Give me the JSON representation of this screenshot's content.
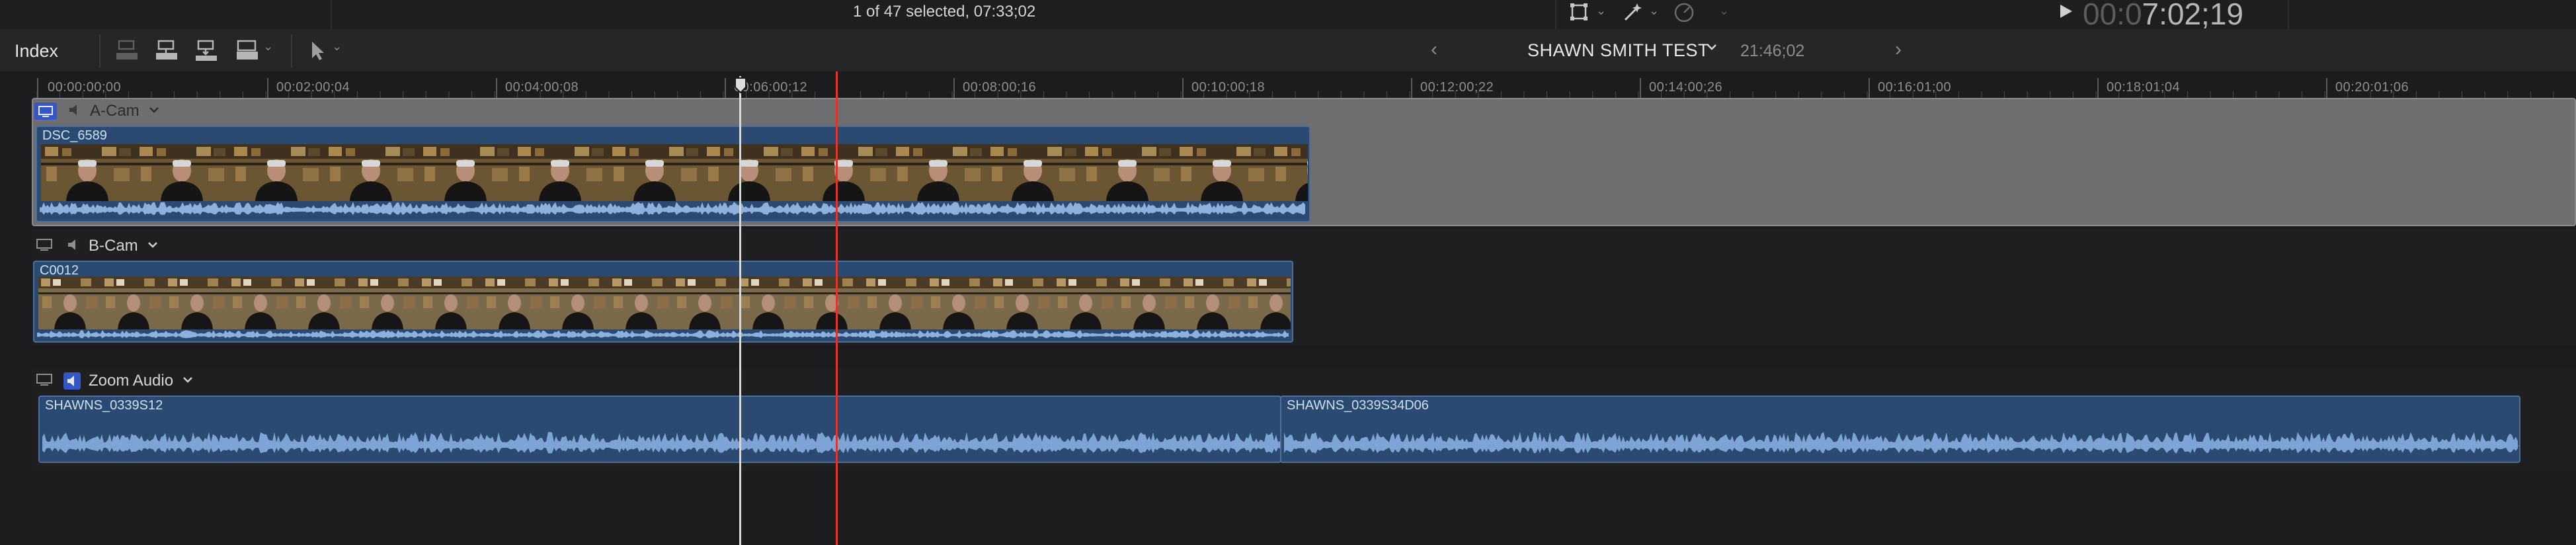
{
  "status": {
    "selection_text": "1 of 47 selected, 07:33;02",
    "timecode_dim": "00:0",
    "timecode_lit": "7:02;19"
  },
  "toolbar": {
    "index_label": "Index",
    "project_title": "SHAWN SMITH TEST",
    "project_duration": "21:46;02",
    "back_glyph": "‹",
    "forward_glyph": "›"
  },
  "ruler": {
    "ticks": [
      "00:00:00;00",
      "00:02:00;04",
      "00:04:00;08",
      "00:06:00;12",
      "00:08:00;16",
      "00:10:00;18",
      "00:12:00;22",
      "00:14:00;26",
      "00:16:01;00",
      "00:18:01;04",
      "00:20:01;06"
    ]
  },
  "tracks": {
    "a_cam": {
      "label": "A-Cam",
      "clip_name": "DSC_6589"
    },
    "b_cam": {
      "label": "B-Cam",
      "clip_name": "C0012"
    },
    "zoom": {
      "label": "Zoom Audio",
      "clip1_name": "SHAWNS_0339S12",
      "clip2_name": "SHAWNS_0339S34D06"
    }
  },
  "colors": {
    "accent_blue": "#2b4a72",
    "playhead_red": "#e0352f",
    "selected_track_gray": "#6e6e70"
  }
}
